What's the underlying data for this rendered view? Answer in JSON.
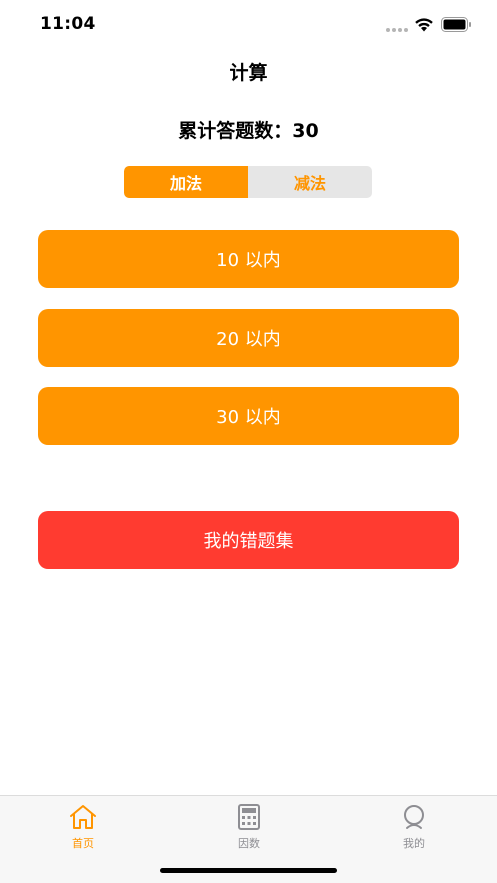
{
  "status_bar": {
    "time": "11:04"
  },
  "nav": {
    "title": "计算"
  },
  "summary": {
    "text": "累计答题数：30"
  },
  "segmented": {
    "items": [
      "加法",
      "减法"
    ],
    "selected": "加法"
  },
  "ranges": [
    {
      "label": "10 以内"
    },
    {
      "label": "20 以内"
    },
    {
      "label": "30 以内"
    }
  ],
  "wrong_set": {
    "label": "我的错题集"
  },
  "tab_bar": {
    "items": [
      {
        "label": "首页",
        "icon": "home-icon",
        "active": true
      },
      {
        "label": "因数",
        "icon": "calculator-icon",
        "active": false
      },
      {
        "label": "我的",
        "icon": "person-icon",
        "active": false
      }
    ]
  },
  "colors": {
    "accent": "#ff9500",
    "danger": "#ff3b30",
    "inactive": "#8e8e93"
  }
}
